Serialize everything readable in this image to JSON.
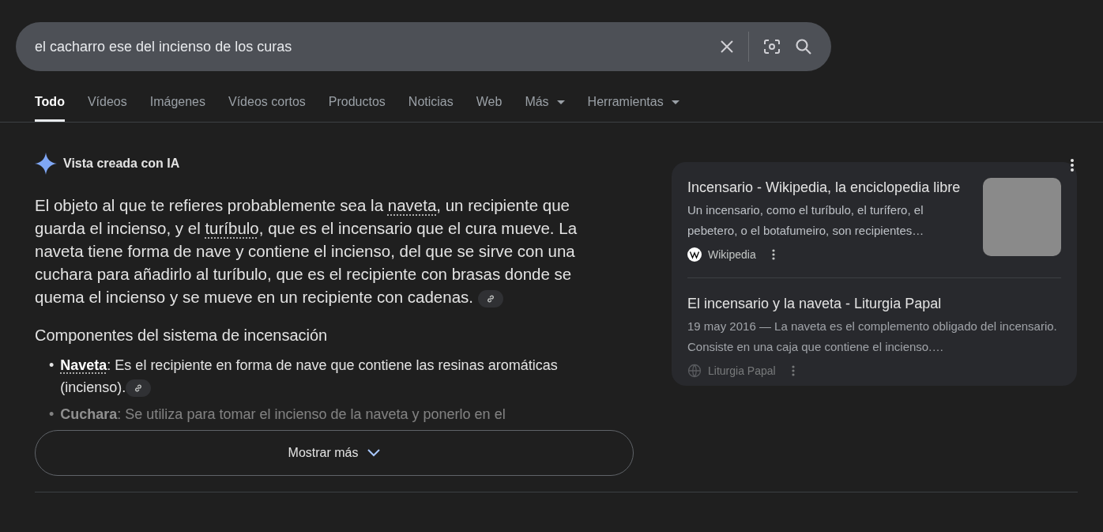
{
  "search": {
    "value": "el cacharro ese del incienso de los curas"
  },
  "tabs": [
    {
      "label": "Todo",
      "selected": true,
      "dropdown": false
    },
    {
      "label": "Vídeos",
      "selected": false,
      "dropdown": false
    },
    {
      "label": "Imágenes",
      "selected": false,
      "dropdown": false
    },
    {
      "label": "Vídeos cortos",
      "selected": false,
      "dropdown": false
    },
    {
      "label": "Productos",
      "selected": false,
      "dropdown": false
    },
    {
      "label": "Noticias",
      "selected": false,
      "dropdown": false
    },
    {
      "label": "Web",
      "selected": false,
      "dropdown": false
    },
    {
      "label": "Más",
      "selected": false,
      "dropdown": true
    },
    {
      "label": "Herramientas",
      "selected": false,
      "dropdown": true
    }
  ],
  "ai_overview": {
    "title": "Vista creada con IA",
    "paragraph": [
      {
        "text": "El objeto al que te refieres probablemente sea la ",
        "kind": "text"
      },
      {
        "text": "naveta",
        "kind": "term"
      },
      {
        "text": ", un recipiente que guarda el incienso, y el ",
        "kind": "text"
      },
      {
        "text": "turíbulo",
        "kind": "term"
      },
      {
        "text": ", que es el incensario que el cura mueve. La naveta tiene forma de nave y contiene el incienso, del que se sirve con una cuchara para añadirlo al turíbulo, que es el recipiente con brasas donde se quema el incienso y se mueve en un recipiente con cadenas.",
        "kind": "text"
      }
    ],
    "heading": "Componentes del sistema de incensación",
    "bullets": [
      {
        "marker": "•",
        "term": "Naveta",
        "underlined": true,
        "text": ": Es el recipiente en forma de nave que contiene las resinas aromáticas (incienso).",
        "link_chip": true
      },
      {
        "marker": "•",
        "term": "Cuchara",
        "underlined": false,
        "text": ": Se utiliza para tomar el incienso de la naveta y ponerlo en el",
        "link_chip": false
      }
    ],
    "show_more": "Mostrar más",
    "sources": [
      {
        "title": "Incensario - Wikipedia, la enciclopedia libre",
        "snippet": "Un incensario, como el turíbulo, el turífero, el pebetero, o el botafumeiro, son recipientes…",
        "site": "Wikipedia",
        "kind": "wiki",
        "thumbnail": true
      },
      {
        "title": "El incensario y la naveta - Liturgia Papal",
        "snippet": "19 may 2016 — La naveta es el complemento obligado del incensario. Consiste en una caja que contiene el incienso.…",
        "site": "Liturgia Papal",
        "kind": "globe",
        "thumbnail": false
      }
    ]
  }
}
